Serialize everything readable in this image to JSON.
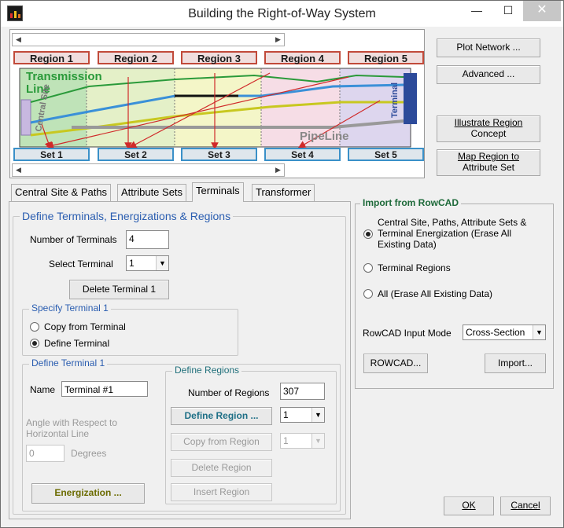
{
  "window": {
    "title": "Building the Right-of-Way System",
    "controls": {
      "minimize": "—",
      "maximize": "☐",
      "close": "✕"
    }
  },
  "diagram": {
    "regions": [
      "Region 1",
      "Region 2",
      "Region 3",
      "Region 4",
      "Region 5"
    ],
    "sets": [
      "Set 1",
      "Set 2",
      "Set 3",
      "Set 4",
      "Set 5"
    ],
    "text": {
      "transmission": "Transmission",
      "line": "Line",
      "central_site": "Central Site",
      "pipeline": "PipeLine",
      "terminal": "Terminal"
    },
    "colors": {
      "region1": "#bfe3b8",
      "region2": "#e4f0c8",
      "region3": "#f4f6c8",
      "region4": "#f6dde6",
      "region5": "#ddd6ee",
      "transmission_line": "#2a9a3a",
      "blue_path": "#3a90d8",
      "yellow_path": "#c8c820",
      "pipeline": "#999999",
      "arrow": "#d02a2a",
      "terminal_bar": "#2c4a9a",
      "central_bar": "#c8b8e0"
    }
  },
  "side_buttons": {
    "plot_network": "Plot Network ...",
    "advanced": "Advanced ...",
    "illustrate_region_line1": "Illustrate Region",
    "illustrate_region_line2": "Concept",
    "map_region_line1": "Map Region to",
    "map_region_line2": "Attribute Set"
  },
  "tabs": [
    "Central Site & Paths",
    "Attribute Sets",
    "Terminals",
    "Transformer"
  ],
  "terminals_panel": {
    "group_title": "Define Terminals, Energizations & Regions",
    "number_of_terminals_label": "Number of Terminals",
    "number_of_terminals_value": "4",
    "select_terminal_label": "Select Terminal",
    "select_terminal_value": "1",
    "delete_terminal_button": "Delete Terminal  1",
    "specify_title": "Specify Terminal  1",
    "copy_from_terminal": "Copy from Terminal",
    "define_terminal": "Define Terminal",
    "define_terminal_title": "Define Terminal  1",
    "name_label": "Name",
    "name_value": "Terminal #1",
    "angle_label_line1": "Angle with Respect to",
    "angle_label_line2": "Horizontal Line",
    "angle_value": "0",
    "degrees_label": "Degrees",
    "energization_button": "Energization ...",
    "define_regions_title": "Define Regions",
    "number_of_regions_label": "Number of Regions",
    "number_of_regions_value": "307",
    "define_region_button": "Define Region ...",
    "define_region_select": "1",
    "copy_from_region_button": "Copy from Region",
    "copy_from_region_select": "1",
    "delete_region_button": "Delete Region",
    "insert_region_button": "Insert Region"
  },
  "import_panel": {
    "title": "Import from RowCAD",
    "option1_line1": "Central Site, Paths, Attribute Sets &",
    "option1_line2": "Terminal Energization (Erase All",
    "option1_line3": "Existing Data)",
    "option2": "Terminal Regions",
    "option3": "All (Erase All Existing Data)",
    "input_mode_label": "RowCAD Input Mode",
    "input_mode_value": "Cross-Section",
    "rowcad_button": "ROWCAD...",
    "import_button": "Import..."
  },
  "footer": {
    "ok": "OK",
    "cancel": "Cancel"
  }
}
